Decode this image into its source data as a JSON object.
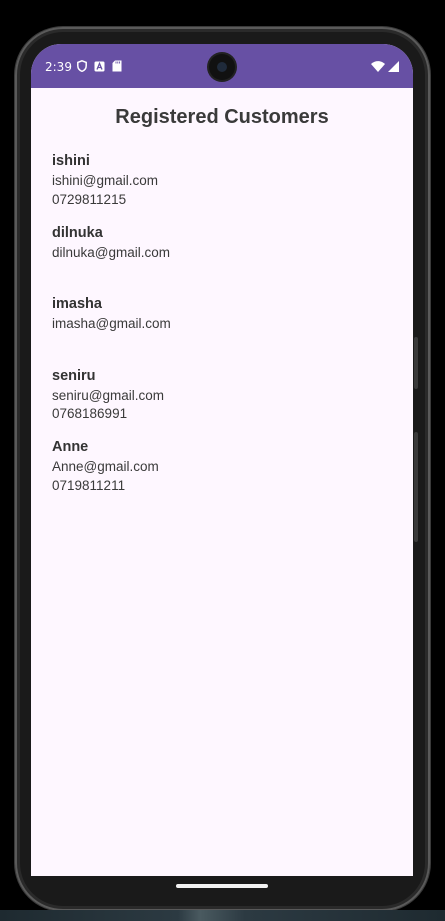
{
  "status_bar": {
    "time": "2:39",
    "background_color": "#6750a4",
    "left_icons": [
      "shield-icon",
      "font-a-icon",
      "sd-card-icon"
    ],
    "right_icons": [
      "wifi-icon",
      "cell-signal-icon"
    ]
  },
  "page": {
    "title": "Registered Customers",
    "background_color": "#fef7ff"
  },
  "customers": [
    {
      "name": "ishini",
      "email": "ishini@gmail.com",
      "phone": "0729811215"
    },
    {
      "name": "dilnuka",
      "email": "dilnuka@gmail.com",
      "phone": ""
    },
    {
      "name": "imasha",
      "email": "imasha@gmail.com",
      "phone": ""
    },
    {
      "name": "seniru",
      "email": "seniru@gmail.com",
      "phone": "0768186991"
    },
    {
      "name": "Anne",
      "email": "Anne@gmail.com",
      "phone": "0719811211"
    }
  ]
}
